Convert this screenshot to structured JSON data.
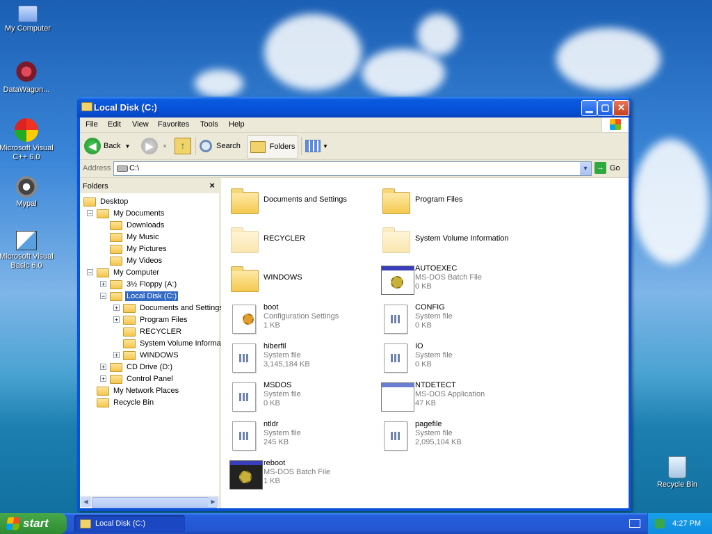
{
  "desktop": {
    "icons": [
      {
        "label": "My Computer"
      },
      {
        "label": "DataWagon..."
      },
      {
        "label": "Microsoft Visual C++ 6.0"
      },
      {
        "label": "Mypal"
      },
      {
        "label": "Microsoft Visual Basic 6.0"
      },
      {
        "label": "Recycle Bin"
      }
    ]
  },
  "window": {
    "title": "Local Disk (C:)",
    "menu": [
      "File",
      "Edit",
      "View",
      "Favorites",
      "Tools",
      "Help"
    ],
    "toolbar": {
      "back": "Back",
      "search": "Search",
      "folders": "Folders"
    },
    "address": {
      "label": "Address",
      "value": "C:\\",
      "go": "Go"
    },
    "folders_pane": {
      "title": "Folders",
      "close": "×",
      "tree": [
        {
          "label": "Desktop",
          "level": 0,
          "expander": ""
        },
        {
          "label": "My Documents",
          "level": 1,
          "expander": "−"
        },
        {
          "label": "Downloads",
          "level": 2,
          "expander": ""
        },
        {
          "label": "My Music",
          "level": 2,
          "expander": ""
        },
        {
          "label": "My Pictures",
          "level": 2,
          "expander": ""
        },
        {
          "label": "My Videos",
          "level": 2,
          "expander": ""
        },
        {
          "label": "My Computer",
          "level": 1,
          "expander": "−"
        },
        {
          "label": "3½ Floppy (A:)",
          "level": 2,
          "expander": "+"
        },
        {
          "label": "Local Disk (C:)",
          "level": 2,
          "expander": "−",
          "selected": true
        },
        {
          "label": "Documents and Settings",
          "level": 3,
          "expander": "+"
        },
        {
          "label": "Program Files",
          "level": 3,
          "expander": "+"
        },
        {
          "label": "RECYCLER",
          "level": 3,
          "expander": ""
        },
        {
          "label": "System Volume Informati",
          "level": 3,
          "expander": ""
        },
        {
          "label": "WINDOWS",
          "level": 3,
          "expander": "+"
        },
        {
          "label": "CD Drive (D:)",
          "level": 2,
          "expander": "+"
        },
        {
          "label": "Control Panel",
          "level": 2,
          "expander": "+"
        },
        {
          "label": "My Network Places",
          "level": 1,
          "expander": ""
        },
        {
          "label": "Recycle Bin",
          "level": 1,
          "expander": ""
        }
      ]
    },
    "files": [
      {
        "name": "Documents and Settings",
        "type": "",
        "size": "",
        "icon": "folder"
      },
      {
        "name": "Program Files",
        "type": "",
        "size": "",
        "icon": "folder"
      },
      {
        "name": "RECYCLER",
        "type": "",
        "size": "",
        "icon": "folder-hidden"
      },
      {
        "name": "System Volume Information",
        "type": "",
        "size": "",
        "icon": "folder-hidden"
      },
      {
        "name": "WINDOWS",
        "type": "",
        "size": "",
        "icon": "folder"
      },
      {
        "name": "AUTOEXEC",
        "type": "MS-DOS Batch File",
        "size": "0 KB",
        "icon": "batch"
      },
      {
        "name": "boot",
        "type": "Configuration Settings",
        "size": "1 KB",
        "icon": "config"
      },
      {
        "name": "CONFIG",
        "type": "System file",
        "size": "0 KB",
        "icon": "sysfile"
      },
      {
        "name": "hiberfil",
        "type": "System file",
        "size": "3,145,184 KB",
        "icon": "sysfile"
      },
      {
        "name": "IO",
        "type": "System file",
        "size": "0 KB",
        "icon": "sysfile"
      },
      {
        "name": "MSDOS",
        "type": "System file",
        "size": "0 KB",
        "icon": "sysfile"
      },
      {
        "name": "NTDETECT",
        "type": "MS-DOS Application",
        "size": "47 KB",
        "icon": "app"
      },
      {
        "name": "ntldr",
        "type": "System file",
        "size": "245 KB",
        "icon": "sysfile"
      },
      {
        "name": "pagefile",
        "type": "System file",
        "size": "2,095,104 KB",
        "icon": "sysfile"
      },
      {
        "name": "reboot",
        "type": "MS-DOS Batch File",
        "size": "1 KB",
        "icon": "batch-dark"
      }
    ]
  },
  "taskbar": {
    "start": "start",
    "task": "Local Disk (C:)",
    "clock": "4:27 PM"
  },
  "colors": {
    "selection": "#316ac5",
    "titlebar": "#0553d9",
    "taskbar": "#245edb",
    "start": "#3a9a3d"
  }
}
